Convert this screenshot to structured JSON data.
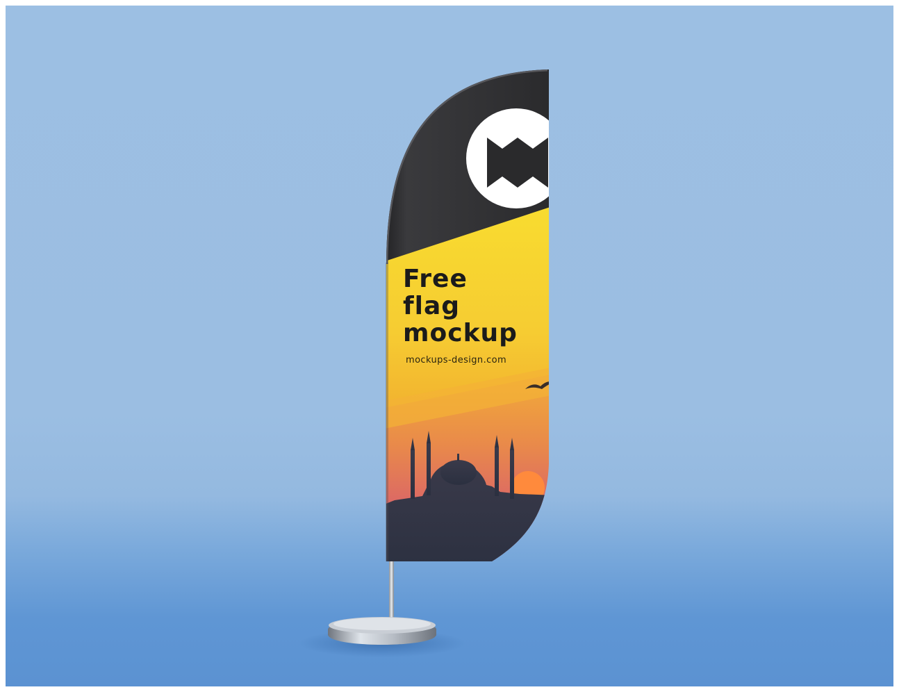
{
  "flag": {
    "headline_line1": "Free",
    "headline_line2": "flag",
    "headline_line3": "mockup",
    "website": "mockups-design.com",
    "logo_icon": "mockups-design-m-logo-icon",
    "photo": "sunset-mosque-silhouette"
  },
  "colors": {
    "background_top": "#9cbfe3",
    "background_floor": "#5b92d2",
    "flag_black": "#2a2a2c",
    "flag_yellow": "#f7d331",
    "flag_orange": "#f0a52d",
    "sunset_pink": "#d9686f",
    "sun": "#ff8a3c"
  }
}
